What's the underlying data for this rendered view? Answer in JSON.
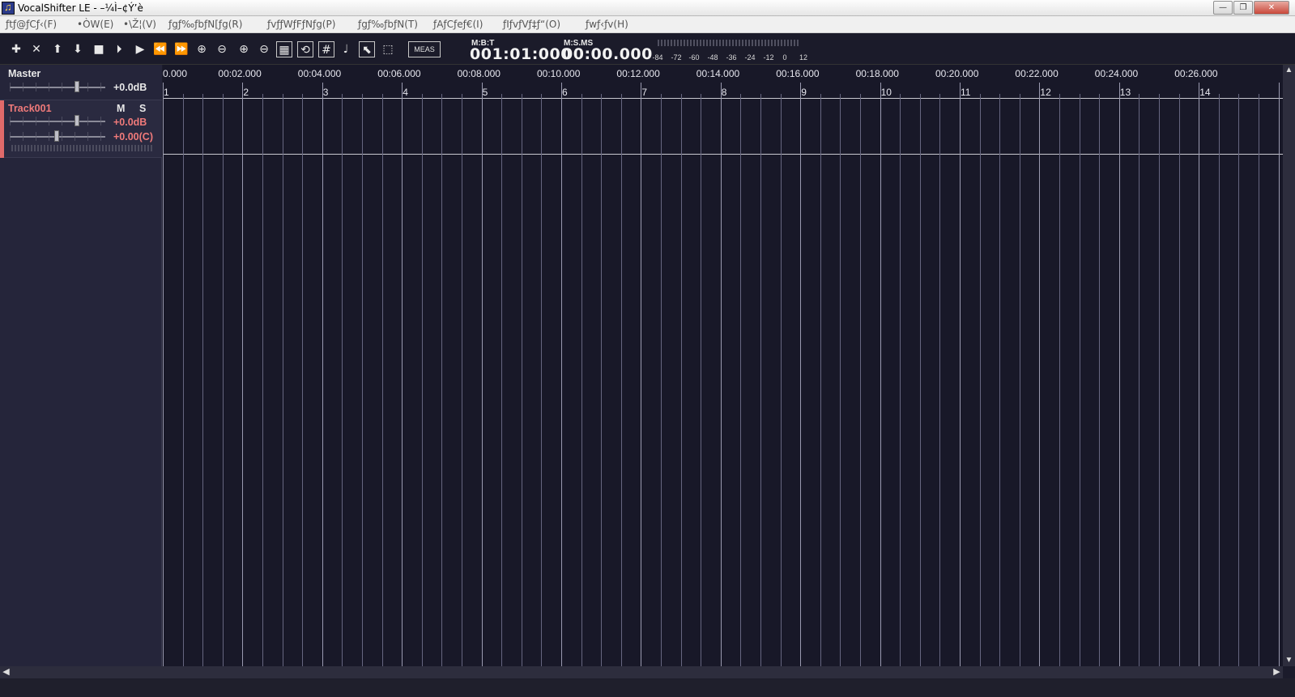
{
  "window": {
    "title": "VocalShifter LE - –¼Ì–¢Ý’è",
    "minimize_glyph": "—",
    "restore_glyph": "❐",
    "close_glyph": "✕"
  },
  "menu": [
    {
      "label": "ƒtƒ@ƒCƒ‹(F)"
    },
    {
      "label": "•ÒW(E)"
    },
    {
      "label": "•\\Ž¦(V)"
    },
    {
      "label": "ƒgƒ‰ƒbƒN[ƒg(R)"
    },
    {
      "label": "ƒvƒƒWƒFƒNƒg(P)"
    },
    {
      "label": "ƒgƒ‰ƒbƒN(T)"
    },
    {
      "label": "ƒAƒCƒeƒ€(I)"
    },
    {
      "label": "ƒIƒvƒVƒ‡ƒ“(O)"
    },
    {
      "label": "ƒwƒ‹ƒv(H)"
    }
  ],
  "toolbar": {
    "icons": [
      {
        "name": "add-icon",
        "glyph": "✚"
      },
      {
        "name": "delete-icon",
        "glyph": "✕"
      },
      {
        "name": "move-up-icon",
        "glyph": "⬆"
      },
      {
        "name": "move-down-icon",
        "glyph": "⬇"
      },
      {
        "name": "stop-icon",
        "glyph": "■"
      },
      {
        "name": "play-from-start-icon",
        "glyph": "⏵"
      },
      {
        "name": "play-icon",
        "glyph": "▶"
      },
      {
        "name": "rewind-icon",
        "glyph": "⏪"
      },
      {
        "name": "fast-forward-icon",
        "glyph": "⏩"
      },
      {
        "name": "zoom-in-horizontal-icon",
        "glyph": "⊕"
      },
      {
        "name": "zoom-out-horizontal-icon",
        "glyph": "⊖"
      },
      {
        "name": "zoom-in-vertical-icon",
        "glyph": "⊕"
      },
      {
        "name": "zoom-out-vertical-icon",
        "glyph": "⊖"
      },
      {
        "name": "scroll-follow-icon",
        "glyph": "▦"
      },
      {
        "name": "loop-icon",
        "glyph": "⟲"
      },
      {
        "name": "grid-icon",
        "glyph": "#"
      },
      {
        "name": "metronome-note-icon",
        "glyph": "♩"
      },
      {
        "name": "pointer-tool-icon",
        "glyph": "⬉"
      },
      {
        "name": "range-select-icon",
        "glyph": "⬚"
      }
    ],
    "meas_label": "MEAS",
    "mbt_label": "M:B:T",
    "mbt_value": "001:01:000",
    "msms_label": "M:S.MS",
    "msms_value": "00:00.000",
    "meter_ticks": [
      "-84",
      "-72",
      "-60",
      "-48",
      "-36",
      "-24",
      "-12",
      "0",
      "12"
    ]
  },
  "master": {
    "label": "Master",
    "volume": "+0.0dB"
  },
  "track": {
    "name": "Track001",
    "mute": "M",
    "solo": "S",
    "volume": "+0.0dB",
    "pan": "+0.00(C)",
    "color": "#e06a6a"
  },
  "timeline": {
    "time_labels": [
      "0.000",
      "00:02.000",
      "00:04.000",
      "00:06.000",
      "00:08.000",
      "00:10.000",
      "00:12.000",
      "00:14.000",
      "00:16.000",
      "00:18.000",
      "00:20.000",
      "00:22.000",
      "00:24.000",
      "00:26.000"
    ],
    "measure_labels": [
      "1",
      "2",
      "3",
      "4",
      "5",
      "6",
      "7",
      "8",
      "9",
      "10",
      "11",
      "12",
      "13",
      "14"
    ],
    "beats_per_measure": 4
  },
  "scroll": {
    "up": "▲",
    "down": "▼",
    "left": "◀",
    "right": "▶"
  }
}
